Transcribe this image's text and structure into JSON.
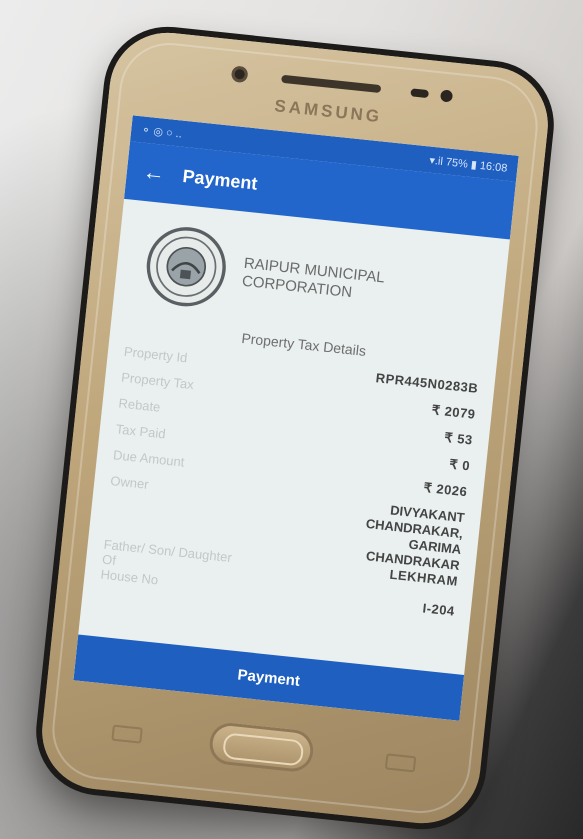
{
  "device": {
    "brand": "SAMSUNG"
  },
  "status_bar": {
    "left": "⚬ ◎ ○ ..",
    "right": "▾.il 75% ▮ 16:08"
  },
  "app_bar": {
    "back_icon": "arrow-left-icon",
    "title": "Payment"
  },
  "organization": {
    "seal_icon": "municipal-seal-icon",
    "name": "RAIPUR MUNICIPAL CORPORATION"
  },
  "section_title": "Property Tax Details",
  "details": [
    {
      "label": "Property Id",
      "value": "RPR445N0283B"
    },
    {
      "label": "Property Tax",
      "value": "₹ 2079"
    },
    {
      "label": "Rebate",
      "value": "₹ 53"
    },
    {
      "label": "Tax Paid",
      "value": "₹ 0"
    },
    {
      "label": "Due Amount",
      "value": "₹ 2026"
    },
    {
      "label": "Owner",
      "value": "DIVYAKANT CHANDRAKAR, GARIMA CHANDRAKAR"
    },
    {
      "label": "Father/ Son/ Daughter Of",
      "value": "LEKHRAM"
    },
    {
      "label": "House No",
      "value": "I-204"
    }
  ],
  "payment_button": "Payment",
  "colors": {
    "primary": "#2266cc",
    "primary_dark": "#1f5fbf",
    "screen_bg": "#e9f0ef",
    "phone_gold": "#bfa67b"
  }
}
